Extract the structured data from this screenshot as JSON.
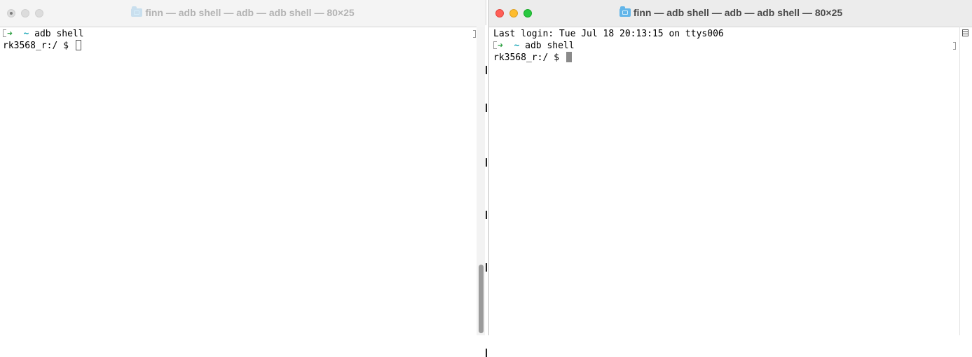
{
  "left_window": {
    "title": "finn — adb shell — adb — adb shell — 80×25",
    "lines": [
      {
        "arrow": "➜",
        "dir": "~",
        "cmd": "adb shell"
      },
      {
        "prompt": "rk3568_r:/ $"
      }
    ]
  },
  "right_window": {
    "title": "finn — adb shell — adb — adb shell — 80×25",
    "lines": [
      {
        "text": "Last login: Tue Jul 18 20:13:15 on ttys006"
      },
      {
        "arrow": "➜",
        "dir": "~",
        "cmd": "adb shell"
      },
      {
        "prompt": "rk3568_r:/ $"
      }
    ]
  },
  "colors": {
    "close": "#ff5f57",
    "minimize": "#febc2e",
    "zoom": "#28c840",
    "prompt_arrow": "#2ea043",
    "prompt_dir": "#1aa6b7"
  },
  "icons": [
    "folder-icon",
    "document-icon",
    "cursor-icon"
  ]
}
